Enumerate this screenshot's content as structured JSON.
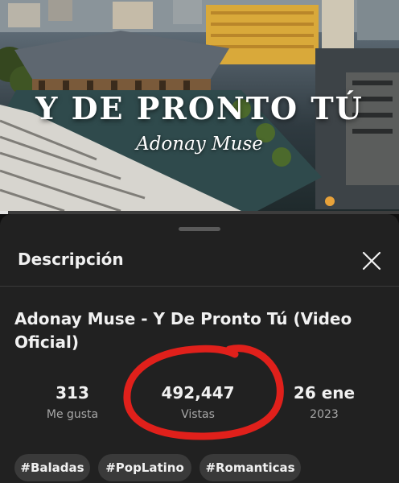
{
  "video": {
    "overlay_title": "Y DE PRONTO TÚ",
    "overlay_artist": "Adonay Muse",
    "progress_fraction": 0.02
  },
  "description_panel": {
    "header": "Descripción",
    "close_icon": "close-icon",
    "title": "Adonay Muse - Y De Pronto Tú (Video Oficial)",
    "stats": {
      "likes": {
        "value": "313",
        "label": "Me gusta"
      },
      "views": {
        "value": "492,447",
        "label": "Vistas"
      },
      "date": {
        "value": "26 ene",
        "label": "2023"
      }
    },
    "annotation_color": "#e0201b",
    "tags": [
      "#Baladas",
      "#PopLatino",
      "#Romanticas"
    ]
  }
}
